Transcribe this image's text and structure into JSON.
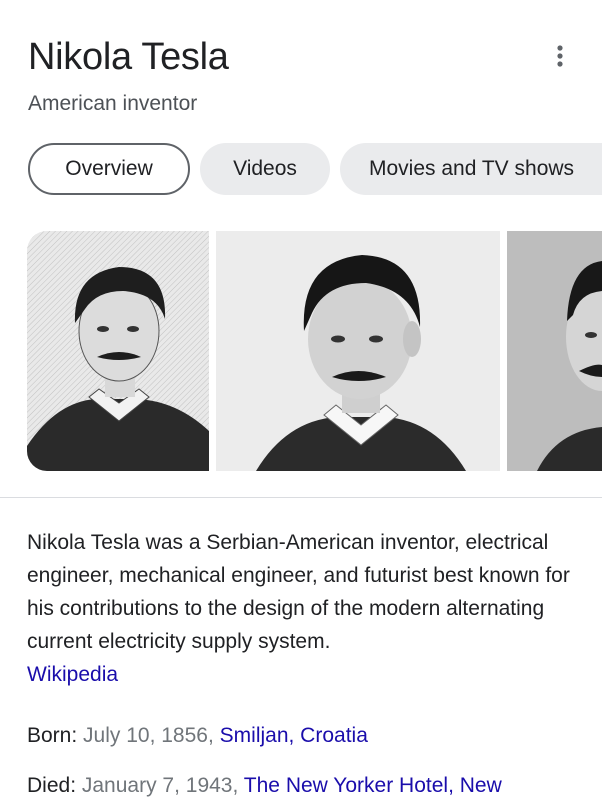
{
  "header": {
    "title": "Nikola Tesla",
    "subtitle": "American inventor",
    "menu_icon": "more-vert-icon"
  },
  "tabs": [
    {
      "label": "Overview",
      "active": true
    },
    {
      "label": "Videos",
      "active": false
    },
    {
      "label": "Movies and TV shows",
      "active": false
    }
  ],
  "images": [
    {
      "kind": "engraving portrait"
    },
    {
      "kind": "photo portrait"
    },
    {
      "kind": "photo portrait (cropped)"
    }
  ],
  "description": {
    "text": "Nikola Tesla was a Serbian-American inventor, electrical engineer, mechanical engineer, and futurist best known for his contributions to the design of the modern alternating current electricity supply system.",
    "source_link": "Wikipedia"
  },
  "facts": {
    "born": {
      "label": "Born:",
      "date": "July 10, 1856,",
      "place": "Smiljan, Croatia"
    },
    "died": {
      "label": "Died:",
      "date": "January 7, 1943,",
      "place": "The New Yorker Hotel, New"
    }
  },
  "colors": {
    "link": "#1a0dab",
    "chip_bg": "#eaebed",
    "secondary_text": "#70757a"
  }
}
